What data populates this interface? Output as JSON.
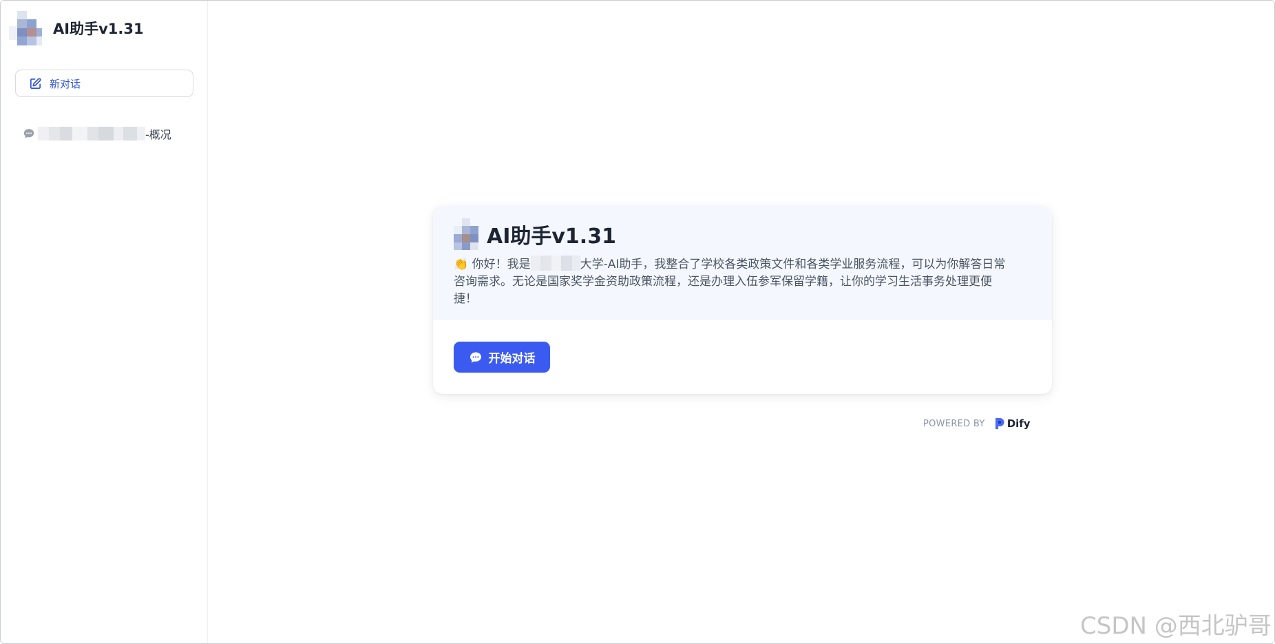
{
  "sidebar": {
    "app_title": "AI助手v1.31",
    "new_chat_label": "新对话",
    "conversations": [
      {
        "label": "-概况"
      }
    ]
  },
  "card": {
    "title": "AI助手v1.31",
    "welcome_emoji": "👏",
    "welcome_lines": [
      {
        "before": "你好！我是",
        "after": "大学-AI助手，我整合了学校各类政策文件和各类学业服务流程，可以为你解答日常"
      },
      {
        "text": "咨询需求。无论是国家奖学金资助政策流程，还是办理入伍参军保留学籍，让你的学习生活事务处理更便"
      },
      {
        "text": "捷！"
      }
    ],
    "start_button_label": "开始对话"
  },
  "footer": {
    "powered_by": "POWERED BY",
    "brand": "Dify"
  },
  "watermark": "CSDN @西北驴哥",
  "colors": {
    "accent": "#3b5bf0",
    "accent_text": "#3155d8",
    "card_head_bg": "#f4f7fd"
  },
  "icons": {
    "new_chat": "edit-icon",
    "conversation": "chat-bubble-icon",
    "start": "chat-bubble-icon",
    "brand": "dify-logo-icon"
  }
}
